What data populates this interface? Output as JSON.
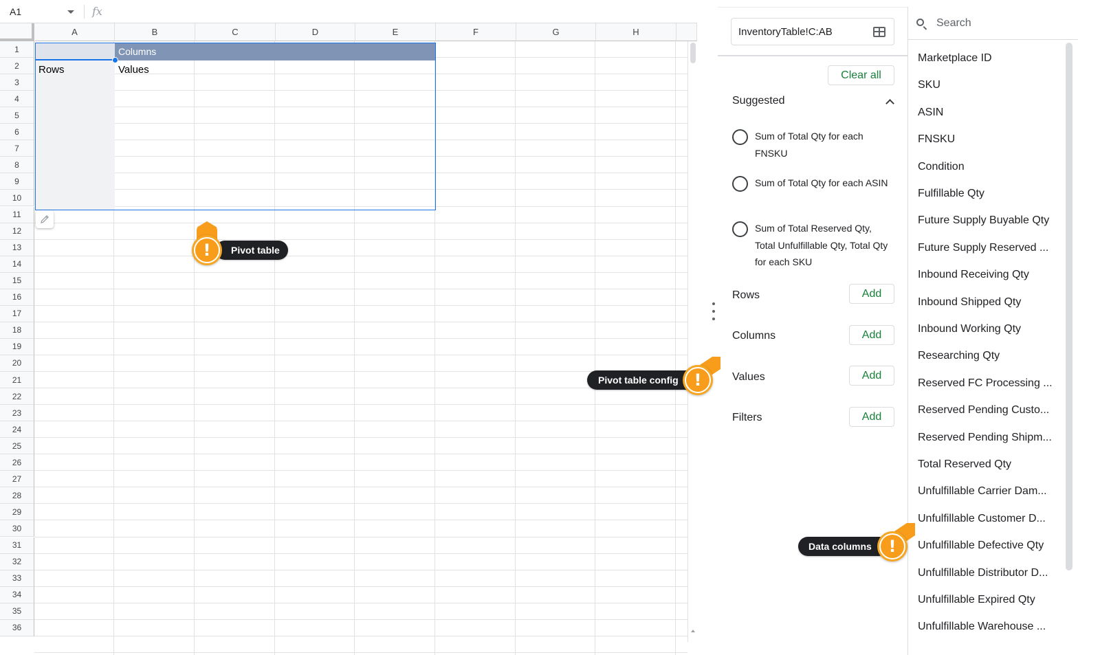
{
  "formula_bar": {
    "cell_ref": "A1",
    "fx_label": "fx"
  },
  "grid": {
    "columns": [
      "A",
      "B",
      "C",
      "D",
      "E",
      "F",
      "G",
      "H"
    ],
    "rows": [
      "1",
      "2",
      "3",
      "4",
      "5",
      "6",
      "7",
      "8",
      "9",
      "10",
      "11",
      "12",
      "13",
      "14",
      "15",
      "16",
      "17",
      "18",
      "19",
      "20",
      "21",
      "22",
      "23",
      "24",
      "25",
      "26",
      "27",
      "28",
      "29",
      "30",
      "31",
      "32",
      "33",
      "34",
      "35",
      "36"
    ]
  },
  "pivot": {
    "columns_label": "Columns",
    "rows_label": "Rows",
    "values_label": "Values"
  },
  "editor": {
    "range": "InventoryTable!C:AB",
    "clear_all": "Clear all",
    "suggested_title": "Suggested",
    "suggestions": [
      "Sum of Total Qty for each FNSKU",
      "Sum of Total Qty for each ASIN",
      "Sum of Total Reserved Qty, Total Unfulfillable Qty, Total Qty for each SKU"
    ],
    "sections": [
      {
        "label": "Rows",
        "button": "Add"
      },
      {
        "label": "Columns",
        "button": "Add"
      },
      {
        "label": "Values",
        "button": "Add"
      },
      {
        "label": "Filters",
        "button": "Add"
      }
    ]
  },
  "fields": {
    "search_placeholder": "Search",
    "items": [
      "Marketplace ID",
      "SKU",
      "ASIN",
      "FNSKU",
      "Condition",
      "Fulfillable Qty",
      "Future Supply Buyable Qty",
      "Future Supply Reserved ...",
      "Inbound Receiving Qty",
      "Inbound Shipped Qty",
      "Inbound Working Qty",
      "Researching Qty",
      "Reserved FC Processing ...",
      "Reserved Pending Custo...",
      "Reserved Pending Shipm...",
      "Total Reserved Qty",
      "Unfulfillable Carrier Dam...",
      "Unfulfillable Customer D...",
      "Unfulfillable Defective Qty",
      "Unfulfillable Distributor D...",
      "Unfulfillable Expired Qty",
      "Unfulfillable Warehouse ..."
    ]
  },
  "callouts": {
    "pivot_table": "Pivot table",
    "pivot_table_config": "Pivot table config",
    "data_columns": "Data columns",
    "badge_symbol": "!"
  },
  "colors": {
    "accent_green": "#188038",
    "selection_blue": "#1a73e8",
    "pivot_header": "#8095b6",
    "callout_orange": "#f89c1c"
  }
}
